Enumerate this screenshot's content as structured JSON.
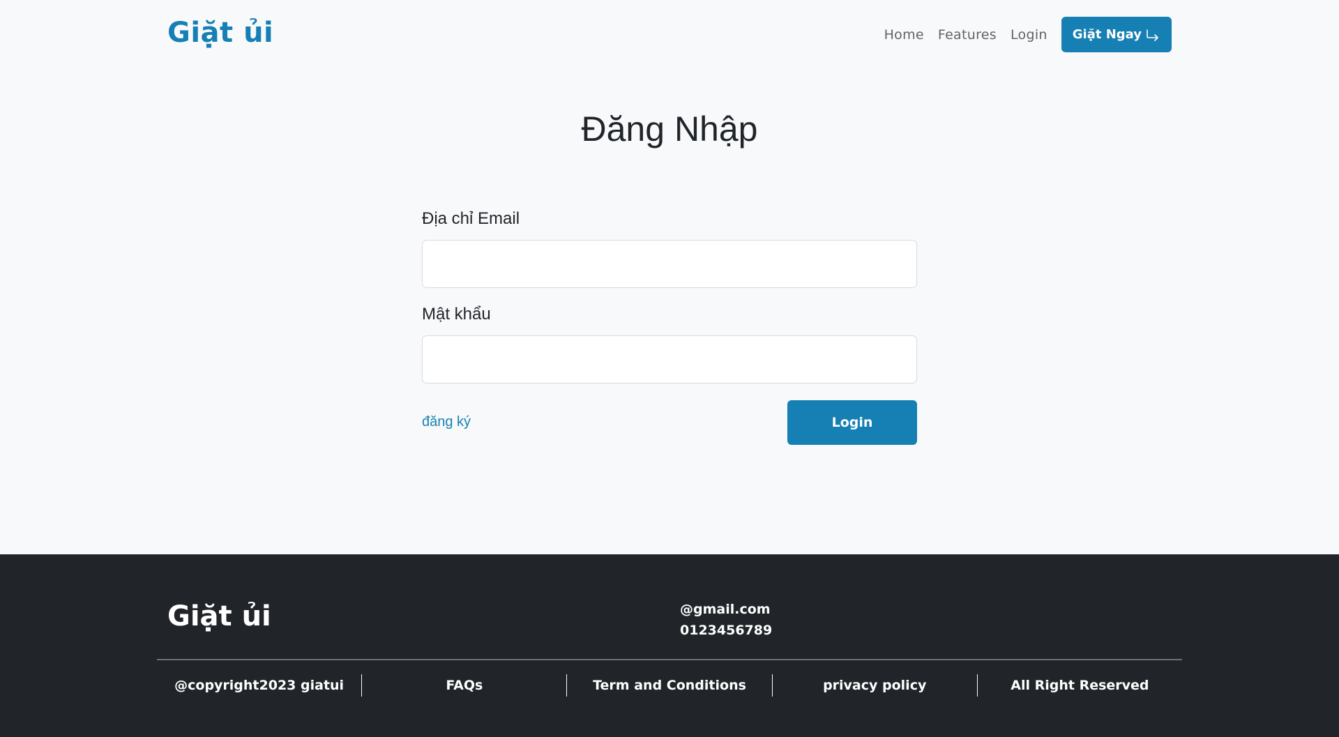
{
  "navbar": {
    "brand": "Giặt ủi",
    "links": [
      "Home",
      "Features",
      "Login"
    ],
    "cta_label": "Giặt Ngay",
    "cta_icon": "arrow-return-right-icon"
  },
  "login_form": {
    "title": "Đăng Nhập",
    "email_label": "Địa chỉ Email",
    "email_value": "",
    "password_label": "Mật khẩu",
    "password_value": "",
    "register_link": "đăng ký",
    "submit_label": "Login"
  },
  "footer": {
    "brand": "Giặt ủi",
    "email": "@gmail.com",
    "phone": "0123456789",
    "links": [
      "@copyright2023 giatui",
      "FAQs",
      "Term and Conditions",
      "privacy policy",
      "All Right Reserved"
    ]
  },
  "colors": {
    "brand": "#167fb3",
    "page_background": "#f7f9fb",
    "footer_background": "#212529"
  }
}
